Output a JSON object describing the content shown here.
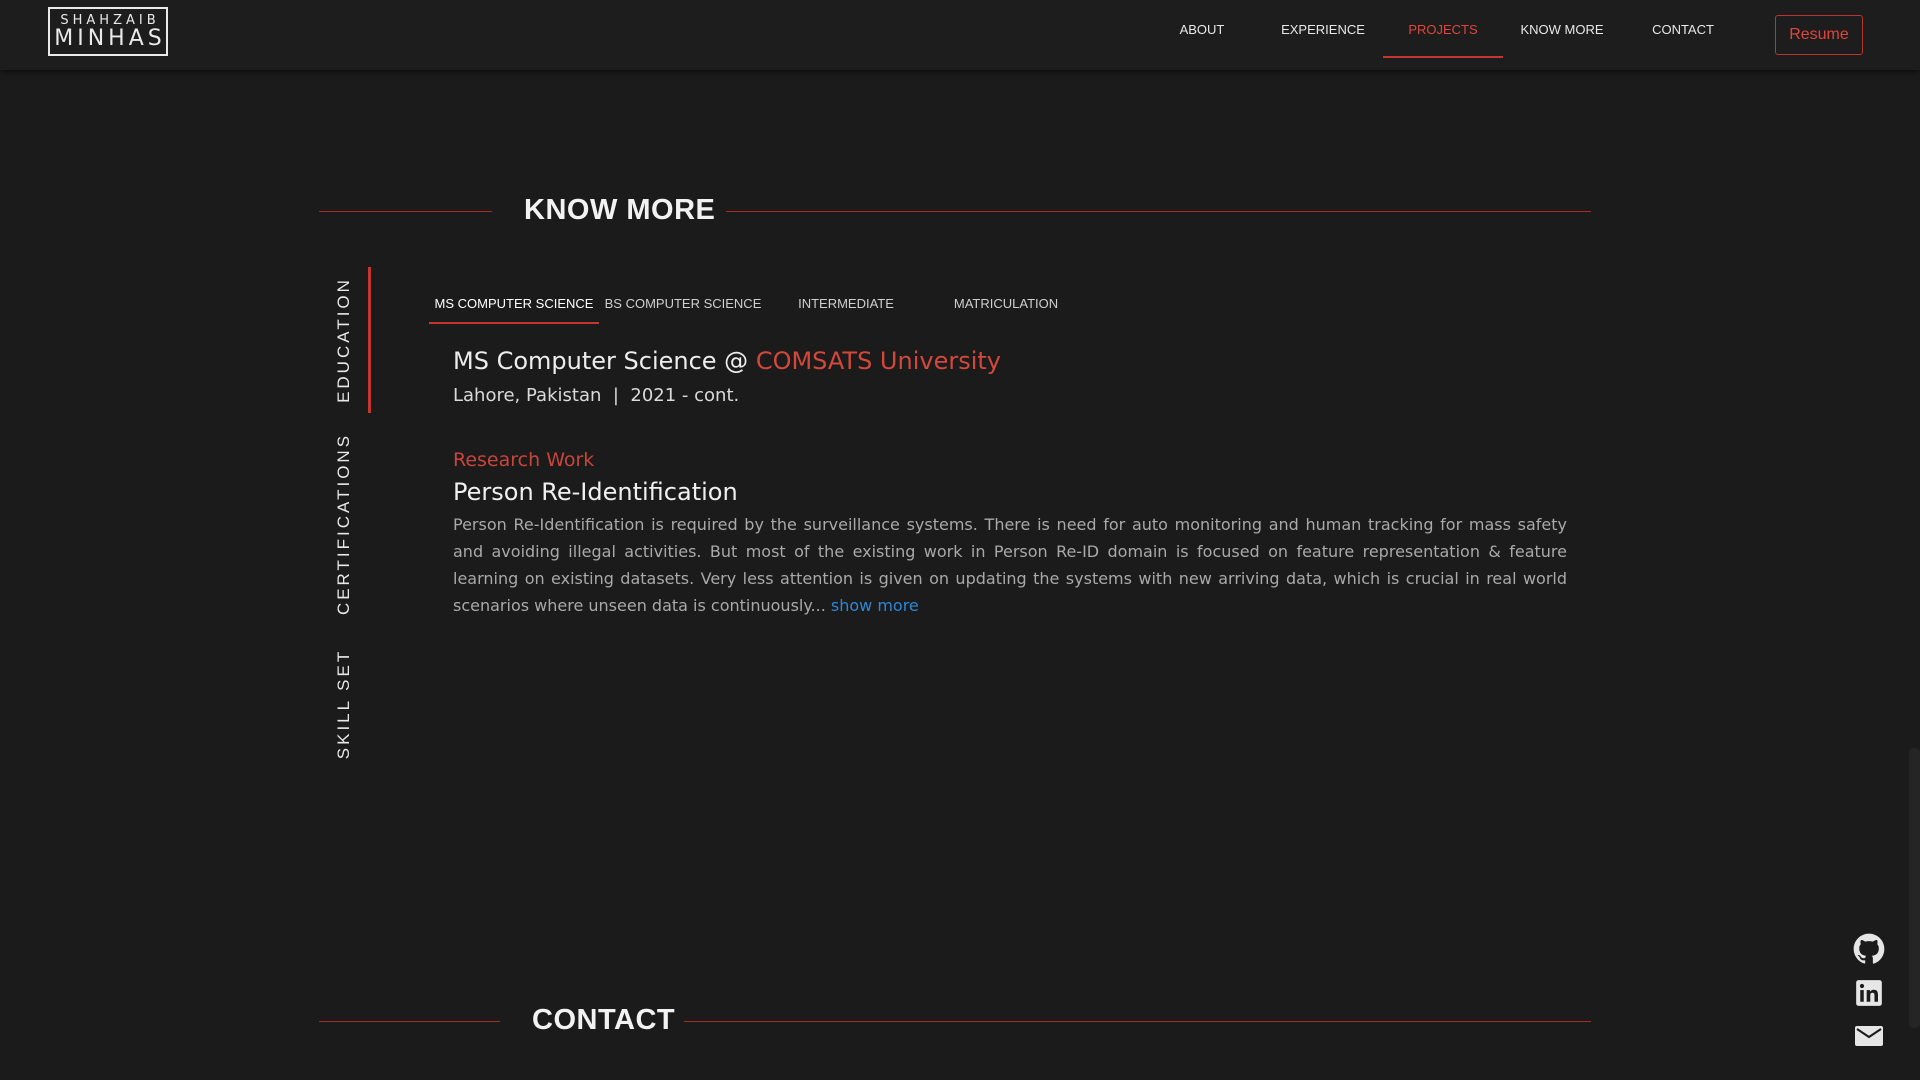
{
  "logo": {
    "line1": "SHAHZAIB",
    "line2": "MINHAS"
  },
  "nav": {
    "items": [
      {
        "label": "ABOUT"
      },
      {
        "label": "EXPERIENCE"
      },
      {
        "label": "PROJECTS",
        "active": true
      },
      {
        "label": "KNOW MORE"
      },
      {
        "label": "CONTACT"
      }
    ],
    "resume_label": "Resume"
  },
  "know_more": {
    "heading": "KNOW MORE",
    "side_tabs": [
      {
        "label": "EDUCATION",
        "active": true
      },
      {
        "label": "CERTIFICATIONS"
      },
      {
        "label": "SKILL SET"
      }
    ],
    "education_tabs": [
      {
        "label": "MS COMPUTER SCIENCE",
        "active": true
      },
      {
        "label": "BS COMPUTER SCIENCE"
      },
      {
        "label": "INTERMEDIATE"
      },
      {
        "label": "MATRICULATION"
      }
    ],
    "degree": {
      "prefix": "MS Computer Science @ ",
      "university": "COMSATS University",
      "location": "Lahore, Pakistan",
      "separator": "|",
      "period": "2021 - cont."
    },
    "research": {
      "label": "Research Work",
      "title": "Person Re-Identification",
      "description": "Person Re-Identification is required by the surveillance systems. There is need for auto monitoring and human tracking for mass safety and avoiding illegal activities. But most of the existing work in Person Re-ID domain is focused on feature representation & feature learning on existing datasets. Very less attention is given on updating the systems with new arriving data, which is crucial in real world scenarios where unseen data is continuously...",
      "show_more": "show more"
    }
  },
  "contact": {
    "heading": "CONTACT"
  },
  "social": [
    {
      "icon": "github-icon"
    },
    {
      "icon": "linkedin-icon"
    },
    {
      "icon": "mail-icon"
    }
  ],
  "colors": {
    "background": "#1b1b1b",
    "accent": "#d4483c",
    "link": "#2f86d6"
  }
}
